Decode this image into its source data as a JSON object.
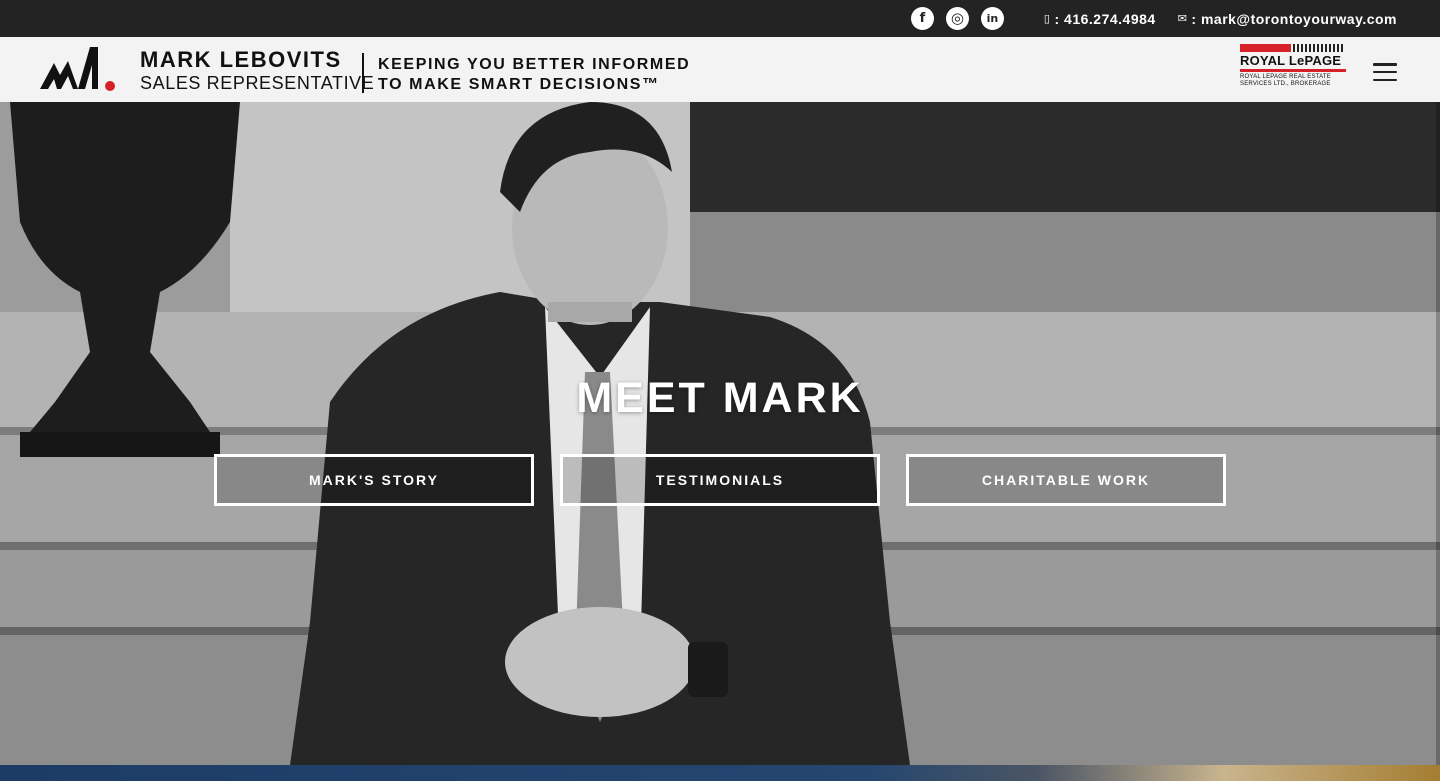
{
  "topbar": {
    "social": [
      {
        "icon": "facebook-icon",
        "glyph": "f"
      },
      {
        "icon": "instagram-icon",
        "glyph": "◎"
      },
      {
        "icon": "linkedin-icon",
        "glyph": "in"
      }
    ],
    "phone_icon": "phone-icon",
    "phone": ": 416.274.4984",
    "email_icon": "mail-icon",
    "email": ": mark@torontoyourway.com"
  },
  "header": {
    "brand_name": "MARK LEBOVITS",
    "brand_role": "SALES REPRESENTATIVE",
    "tagline_line1": "KEEPING YOU BETTER INFORMED",
    "tagline_line2": "TO MAKE SMART DECISIONS™",
    "partner": {
      "name": "ROYAL LePAGE",
      "sub_line1": "ROYAL LEPAGE REAL ESTATE",
      "sub_line2": "SERVICES LTD., BROKERAGE"
    },
    "menu_icon": "hamburger-menu-icon"
  },
  "hero": {
    "title": "MEET MARK",
    "buttons": [
      {
        "label": "MARK'S STORY"
      },
      {
        "label": "TESTIMONIALS"
      },
      {
        "label": "CHARITABLE WORK"
      }
    ]
  },
  "colors": {
    "topbar_bg": "#232323",
    "header_bg": "#f3f3f3",
    "brand_red": "#d6202a",
    "text_dark": "#111111"
  }
}
